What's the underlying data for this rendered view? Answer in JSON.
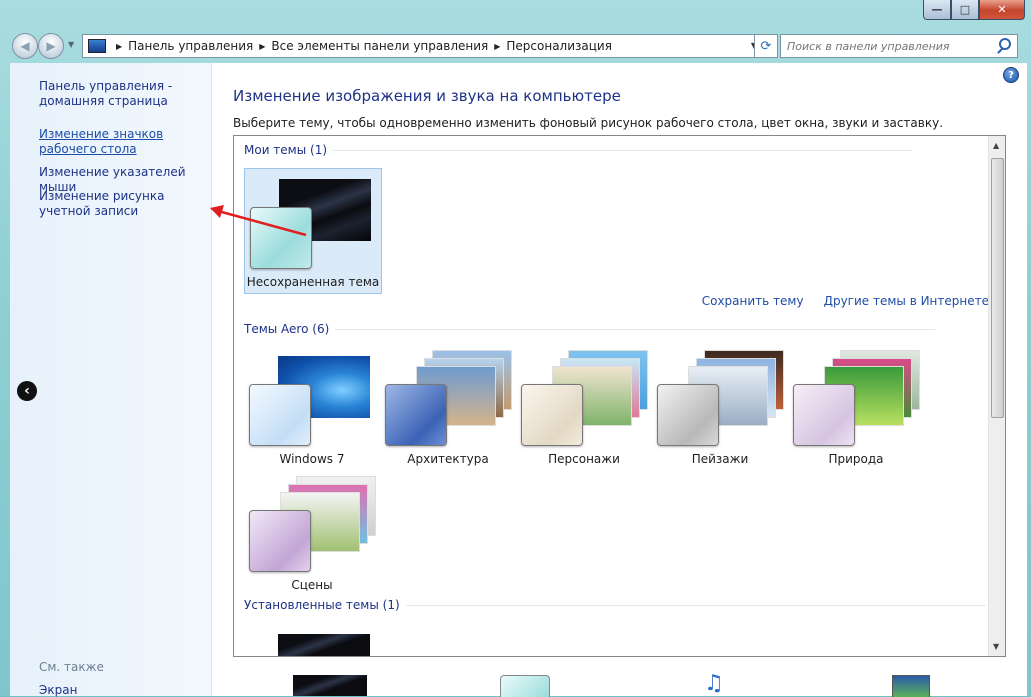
{
  "window": {
    "min_glyph": "—",
    "max_glyph": "□",
    "close_glyph": "✕"
  },
  "address": {
    "crumbs": [
      "Панель управления",
      "Все элементы панели управления",
      "Персонализация"
    ],
    "search_placeholder": "Поиск в панели управления"
  },
  "sidebar": {
    "home_label": "Панель управления - домашняя страница",
    "links": [
      "Изменение значков рабочего стола",
      "Изменение указателей мыши",
      "Изменение рисунка учетной записи"
    ],
    "see_also": "См. также",
    "screen": "Экран"
  },
  "main": {
    "title": "Изменение изображения и звука на компьютере",
    "description": "Выберите тему, чтобы одновременно изменить фоновый рисунок рабочего стола, цвет окна, звуки и заставку.",
    "my_themes_header": "Мои темы (1)",
    "unsaved_theme": "Несохраненная тема",
    "save_theme": "Сохранить тему",
    "more_themes": "Другие темы в Интернете",
    "aero_header": "Темы Aero (6)",
    "aero_themes": [
      "Windows 7",
      "Архитектура",
      "Персонажи",
      "Пейзажи",
      "Природа",
      "Сцены"
    ],
    "installed_header": "Установленные темы (1)"
  },
  "colors": {
    "link": "#1e4ea8",
    "heading": "#1e3287",
    "selection": "#dbeaf9",
    "annotation_arrow": "#e02020"
  },
  "icons": [
    "computer-icon",
    "refresh-icon",
    "search-icon",
    "help-icon",
    "back-arrow-icon",
    "music-icon"
  ]
}
